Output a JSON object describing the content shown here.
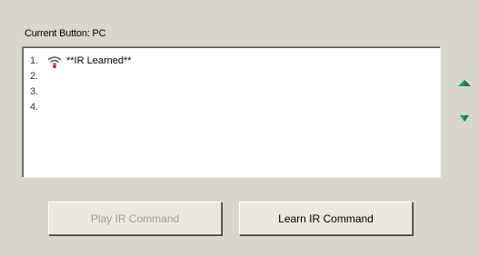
{
  "current_button": {
    "label": "Current Button: PC"
  },
  "list": {
    "items": [
      {
        "number": "1.",
        "icon": "ir-signal-icon",
        "text": "**IR Learned**"
      },
      {
        "number": "2.",
        "icon": null,
        "text": ""
      },
      {
        "number": "3.",
        "icon": null,
        "text": ""
      },
      {
        "number": "4.",
        "icon": null,
        "text": ""
      }
    ]
  },
  "controls": {
    "move_up_icon": "arrow-up-icon",
    "move_down_icon": "arrow-down-icon",
    "arrow_color": "#1f9e5a"
  },
  "buttons": {
    "play_label": "Play IR Command",
    "play_enabled": false,
    "learn_label": "Learn IR Command",
    "learn_enabled": true
  },
  "colors": {
    "background": "#d9d6cd",
    "list_background": "#ffffff",
    "icon_red": "#c0141c"
  }
}
